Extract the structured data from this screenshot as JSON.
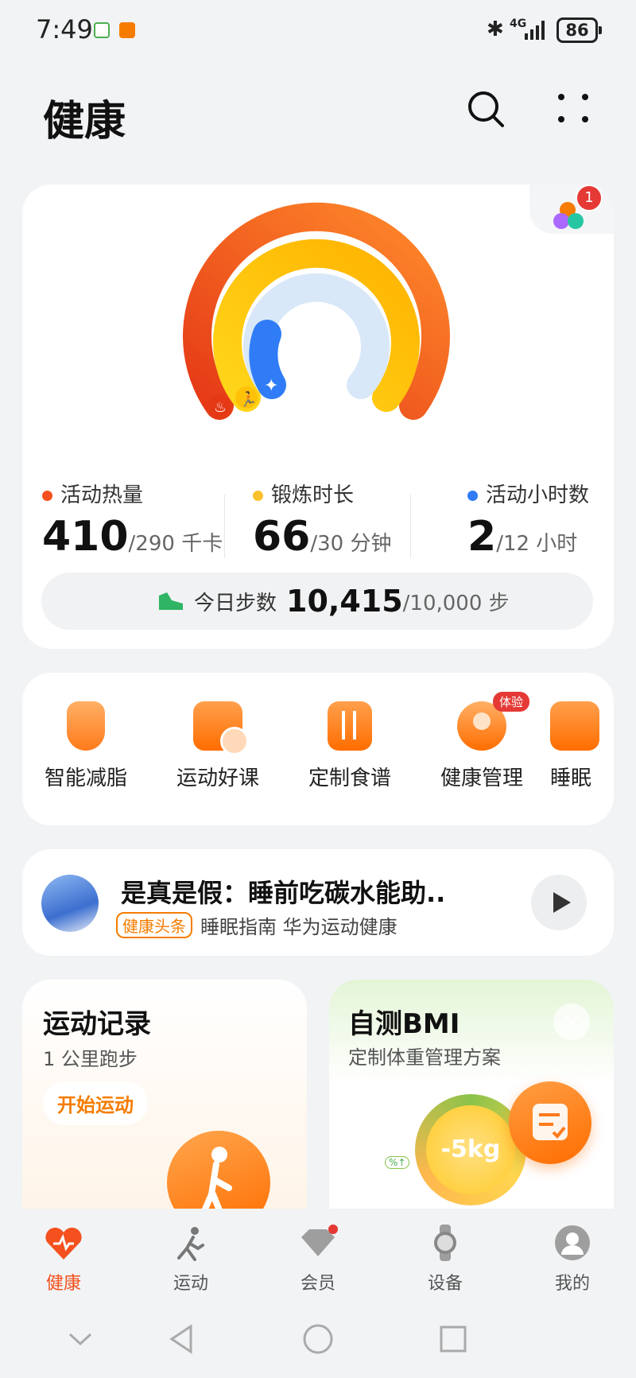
{
  "status_bar": {
    "time": "7:49",
    "network": "4G",
    "battery": "86"
  },
  "header": {
    "title": "健康"
  },
  "activity": {
    "calories": {
      "label": "活动热量",
      "value": "410",
      "goal": "/290 千卡",
      "color": "#f4511e",
      "progress": 1.41
    },
    "exercise": {
      "label": "锻炼时长",
      "value": "66",
      "goal": "/30 分钟",
      "color": "#fbc02d",
      "progress": 2.2
    },
    "active_hours": {
      "label": "活动小时数",
      "value": "2",
      "goal": "/12 小时",
      "color": "#2f7cf6",
      "progress": 0.17
    },
    "steps": {
      "label": "今日步数",
      "value": "10,415",
      "goal": "/10,000 步"
    },
    "badge_count": "1"
  },
  "quick_actions": [
    {
      "label": "智能减脂",
      "icon": "body-shape-icon"
    },
    {
      "label": "运动好课",
      "icon": "video-course-icon"
    },
    {
      "label": "定制食谱",
      "icon": "fork-knife-icon"
    },
    {
      "label": "健康管理",
      "icon": "doctor-icon",
      "badge": "体验"
    },
    {
      "label": "睡眠",
      "icon": "sleep-icon"
    }
  ],
  "news": {
    "title": "是真是假：睡前吃碳水能助..",
    "tag": "健康头条",
    "meta": "睡眠指南 华为运动健康"
  },
  "exercise_card": {
    "title": "运动记录",
    "subtitle": "1 公里跑步",
    "button": "开始运动"
  },
  "bmi_card": {
    "title": "自测BMI",
    "subtitle": "定制体重管理方案",
    "gauge_text": "-5kg",
    "mini_label": "%↑"
  },
  "tabs": [
    {
      "label": "健康",
      "icon": "heart-icon",
      "active": true
    },
    {
      "label": "运动",
      "icon": "runner-icon"
    },
    {
      "label": "会员",
      "icon": "vip-diamond-icon",
      "dot": true
    },
    {
      "label": "设备",
      "icon": "watch-icon"
    },
    {
      "label": "我的",
      "icon": "profile-icon"
    }
  ],
  "colors": {
    "accent": "#f4511e",
    "tab_active": "#f4511e"
  }
}
